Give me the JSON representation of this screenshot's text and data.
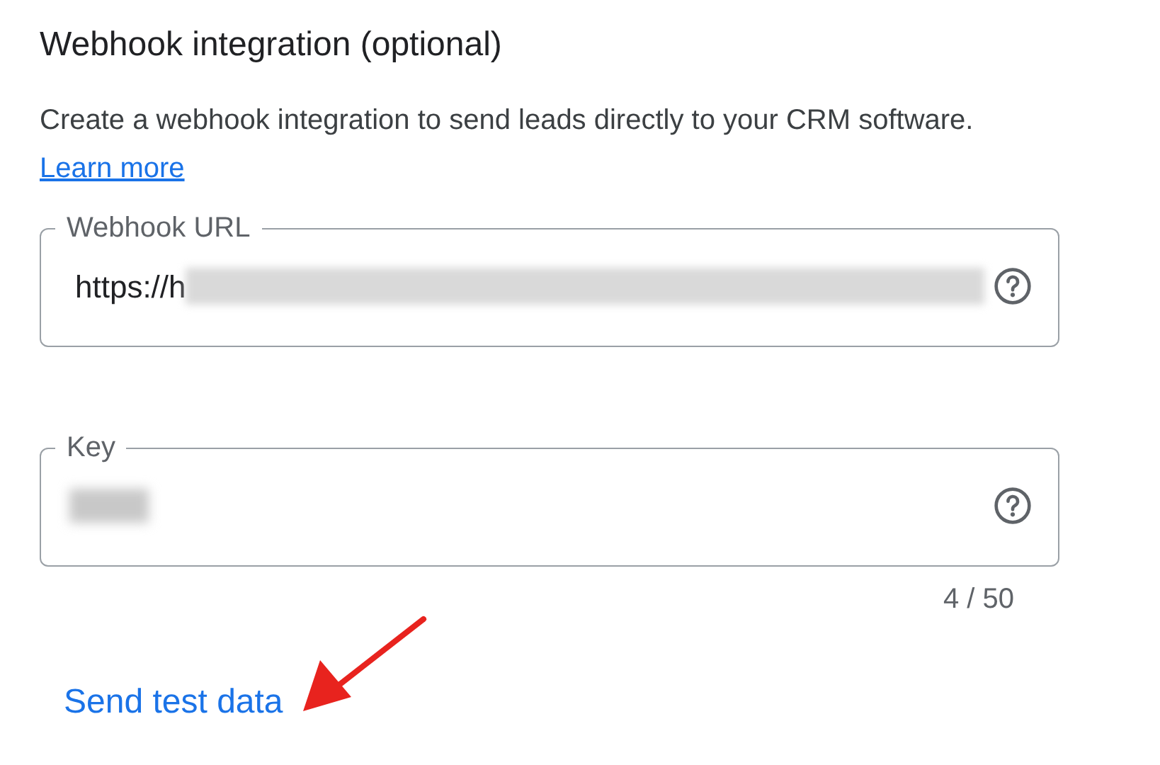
{
  "section": {
    "title": "Webhook integration (optional)",
    "description": "Create a webhook integration to send leads directly to your CRM software.",
    "link": "Learn more"
  },
  "fields": [
    {
      "label": "Webhook URL",
      "value": "https://h",
      "redacted": true
    },
    {
      "label": "Key",
      "redacted": true,
      "counter": "4 / 50"
    }
  ],
  "action": {
    "label": "Send test data"
  }
}
